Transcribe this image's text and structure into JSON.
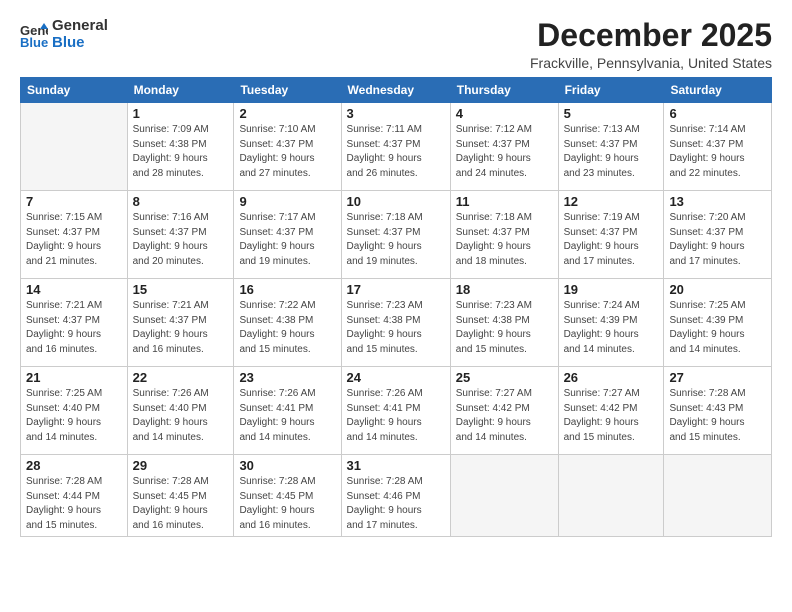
{
  "header": {
    "logo_line1": "General",
    "logo_line2": "Blue",
    "month": "December 2025",
    "location": "Frackville, Pennsylvania, United States"
  },
  "days_of_week": [
    "Sunday",
    "Monday",
    "Tuesday",
    "Wednesday",
    "Thursday",
    "Friday",
    "Saturday"
  ],
  "weeks": [
    [
      {
        "num": "",
        "info": ""
      },
      {
        "num": "1",
        "info": "Sunrise: 7:09 AM\nSunset: 4:38 PM\nDaylight: 9 hours\nand 28 minutes."
      },
      {
        "num": "2",
        "info": "Sunrise: 7:10 AM\nSunset: 4:37 PM\nDaylight: 9 hours\nand 27 minutes."
      },
      {
        "num": "3",
        "info": "Sunrise: 7:11 AM\nSunset: 4:37 PM\nDaylight: 9 hours\nand 26 minutes."
      },
      {
        "num": "4",
        "info": "Sunrise: 7:12 AM\nSunset: 4:37 PM\nDaylight: 9 hours\nand 24 minutes."
      },
      {
        "num": "5",
        "info": "Sunrise: 7:13 AM\nSunset: 4:37 PM\nDaylight: 9 hours\nand 23 minutes."
      },
      {
        "num": "6",
        "info": "Sunrise: 7:14 AM\nSunset: 4:37 PM\nDaylight: 9 hours\nand 22 minutes."
      }
    ],
    [
      {
        "num": "7",
        "info": "Sunrise: 7:15 AM\nSunset: 4:37 PM\nDaylight: 9 hours\nand 21 minutes."
      },
      {
        "num": "8",
        "info": "Sunrise: 7:16 AM\nSunset: 4:37 PM\nDaylight: 9 hours\nand 20 minutes."
      },
      {
        "num": "9",
        "info": "Sunrise: 7:17 AM\nSunset: 4:37 PM\nDaylight: 9 hours\nand 19 minutes."
      },
      {
        "num": "10",
        "info": "Sunrise: 7:18 AM\nSunset: 4:37 PM\nDaylight: 9 hours\nand 19 minutes."
      },
      {
        "num": "11",
        "info": "Sunrise: 7:18 AM\nSunset: 4:37 PM\nDaylight: 9 hours\nand 18 minutes."
      },
      {
        "num": "12",
        "info": "Sunrise: 7:19 AM\nSunset: 4:37 PM\nDaylight: 9 hours\nand 17 minutes."
      },
      {
        "num": "13",
        "info": "Sunrise: 7:20 AM\nSunset: 4:37 PM\nDaylight: 9 hours\nand 17 minutes."
      }
    ],
    [
      {
        "num": "14",
        "info": "Sunrise: 7:21 AM\nSunset: 4:37 PM\nDaylight: 9 hours\nand 16 minutes."
      },
      {
        "num": "15",
        "info": "Sunrise: 7:21 AM\nSunset: 4:37 PM\nDaylight: 9 hours\nand 16 minutes."
      },
      {
        "num": "16",
        "info": "Sunrise: 7:22 AM\nSunset: 4:38 PM\nDaylight: 9 hours\nand 15 minutes."
      },
      {
        "num": "17",
        "info": "Sunrise: 7:23 AM\nSunset: 4:38 PM\nDaylight: 9 hours\nand 15 minutes."
      },
      {
        "num": "18",
        "info": "Sunrise: 7:23 AM\nSunset: 4:38 PM\nDaylight: 9 hours\nand 15 minutes."
      },
      {
        "num": "19",
        "info": "Sunrise: 7:24 AM\nSunset: 4:39 PM\nDaylight: 9 hours\nand 14 minutes."
      },
      {
        "num": "20",
        "info": "Sunrise: 7:25 AM\nSunset: 4:39 PM\nDaylight: 9 hours\nand 14 minutes."
      }
    ],
    [
      {
        "num": "21",
        "info": "Sunrise: 7:25 AM\nSunset: 4:40 PM\nDaylight: 9 hours\nand 14 minutes."
      },
      {
        "num": "22",
        "info": "Sunrise: 7:26 AM\nSunset: 4:40 PM\nDaylight: 9 hours\nand 14 minutes."
      },
      {
        "num": "23",
        "info": "Sunrise: 7:26 AM\nSunset: 4:41 PM\nDaylight: 9 hours\nand 14 minutes."
      },
      {
        "num": "24",
        "info": "Sunrise: 7:26 AM\nSunset: 4:41 PM\nDaylight: 9 hours\nand 14 minutes."
      },
      {
        "num": "25",
        "info": "Sunrise: 7:27 AM\nSunset: 4:42 PM\nDaylight: 9 hours\nand 14 minutes."
      },
      {
        "num": "26",
        "info": "Sunrise: 7:27 AM\nSunset: 4:42 PM\nDaylight: 9 hours\nand 15 minutes."
      },
      {
        "num": "27",
        "info": "Sunrise: 7:28 AM\nSunset: 4:43 PM\nDaylight: 9 hours\nand 15 minutes."
      }
    ],
    [
      {
        "num": "28",
        "info": "Sunrise: 7:28 AM\nSunset: 4:44 PM\nDaylight: 9 hours\nand 15 minutes."
      },
      {
        "num": "29",
        "info": "Sunrise: 7:28 AM\nSunset: 4:45 PM\nDaylight: 9 hours\nand 16 minutes."
      },
      {
        "num": "30",
        "info": "Sunrise: 7:28 AM\nSunset: 4:45 PM\nDaylight: 9 hours\nand 16 minutes."
      },
      {
        "num": "31",
        "info": "Sunrise: 7:28 AM\nSunset: 4:46 PM\nDaylight: 9 hours\nand 17 minutes."
      },
      {
        "num": "",
        "info": ""
      },
      {
        "num": "",
        "info": ""
      },
      {
        "num": "",
        "info": ""
      }
    ]
  ]
}
